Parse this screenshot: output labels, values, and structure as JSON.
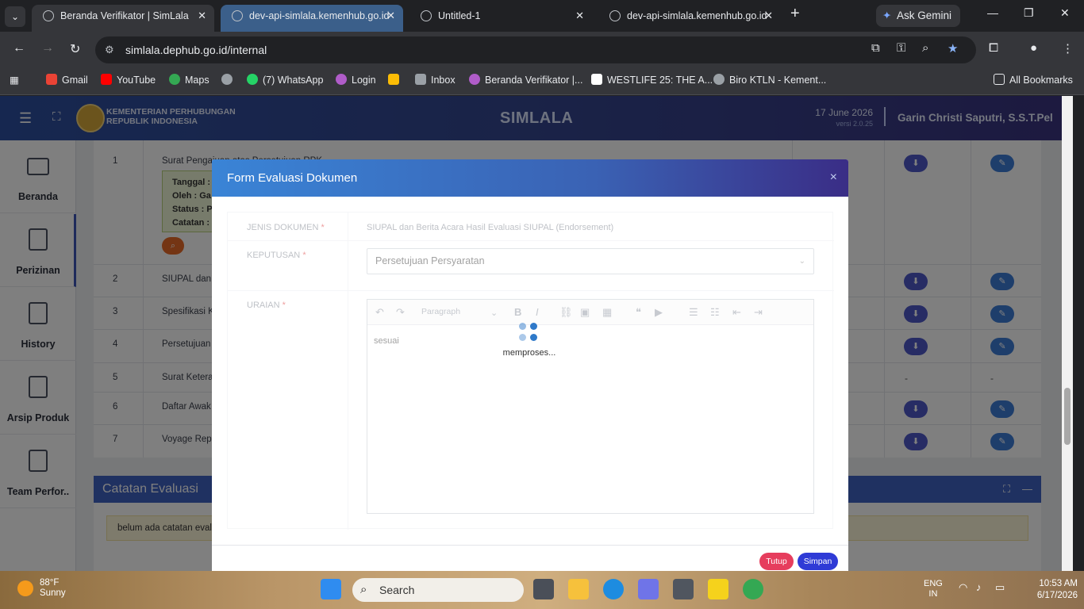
{
  "browser": {
    "tabs": [
      {
        "title": "Beranda Verifikator | SimLala"
      },
      {
        "title": "dev-api-simlala.kemenhub.go.id"
      },
      {
        "title": "Untitled-1"
      },
      {
        "title": "dev-api-simlala.kemenhub.go.id"
      }
    ],
    "gemini_label": "Ask Gemini",
    "url": "simlala.dephub.go.id/internal",
    "bookmarks": [
      {
        "label": "Gmail"
      },
      {
        "label": "YouTube"
      },
      {
        "label": "Maps"
      },
      {
        "label": "(7) WhatsApp"
      },
      {
        "label": "Login"
      },
      {
        "label": "Inbox"
      },
      {
        "label": "Beranda Verifikator |..."
      },
      {
        "label": "WESTLIFE 25: THE A..."
      },
      {
        "label": "Biro KTLN - Kement..."
      }
    ],
    "all_bookmarks": "All Bookmarks"
  },
  "app": {
    "ministry_line1": "KEMENTERIAN PERHUBUNGAN",
    "ministry_line2": "REPUBLIK INDONESIA",
    "title": "SIMLALA",
    "date": "17 June 2026",
    "version": "versi 2.0.25",
    "user": "Garin Christi Saputri, S.S.T.Pel"
  },
  "sidebar": {
    "items": [
      {
        "label": "Beranda",
        "icon": "monitor-icon"
      },
      {
        "label": "Perizinan",
        "icon": "document-icon"
      },
      {
        "label": "History",
        "icon": "document-icon"
      },
      {
        "label": "Arsip Produk",
        "icon": "document-icon"
      },
      {
        "label": "Team Perfor..",
        "icon": "document-icon"
      }
    ]
  },
  "table": {
    "rows": [
      {
        "no": "1",
        "doc": "Surat Pengajuan atas Persetujuan RPK"
      },
      {
        "no": "2",
        "doc": "SIUPAL dan B"
      },
      {
        "no": "3",
        "doc": "Spesifikasi Ka"
      },
      {
        "no": "4",
        "doc": "Persetujuan S"
      },
      {
        "no": "5",
        "doc": "Surat Keteran"
      },
      {
        "no": "6",
        "doc": "Daftar Awak"
      },
      {
        "no": "7",
        "doc": "Voyage Repo"
      }
    ],
    "info": {
      "tanggal": "Tanggal :",
      "oleh": "Oleh : Ga",
      "status": "Status : P",
      "catatan": "Catatan :"
    },
    "dash": "-"
  },
  "catatan": {
    "title": "Catatan Evaluasi",
    "note": "belum ada catatan evalu"
  },
  "modal": {
    "title": "Form Evaluasi Dokumen",
    "close": "×",
    "jenis_label": "JENIS DOKUMEN",
    "jenis_value": "SIUPAL dan Berita Acara Hasil Evaluasi SIUPAL (Endorsement)",
    "keputusan_label": "KEPUTUSAN",
    "keputusan_value": "Persetujuan Persyaratan",
    "uraian_label": "URAIAN",
    "required": "*",
    "paragraph": "Paragraph",
    "editor_text": "sesuai",
    "loading": "memproses...",
    "btn_tutup": "Tutup",
    "btn_simpan": "Simpan"
  },
  "taskbar": {
    "temp": "88°F",
    "weather": "Sunny",
    "search": "Search",
    "lang1": "ENG",
    "lang2": "IN",
    "time": "10:53 AM",
    "date": "6/17/2026"
  },
  "colors": {
    "accent": "#3f62c2",
    "danger": "#e63d5d",
    "primary": "#2f3bd6"
  }
}
